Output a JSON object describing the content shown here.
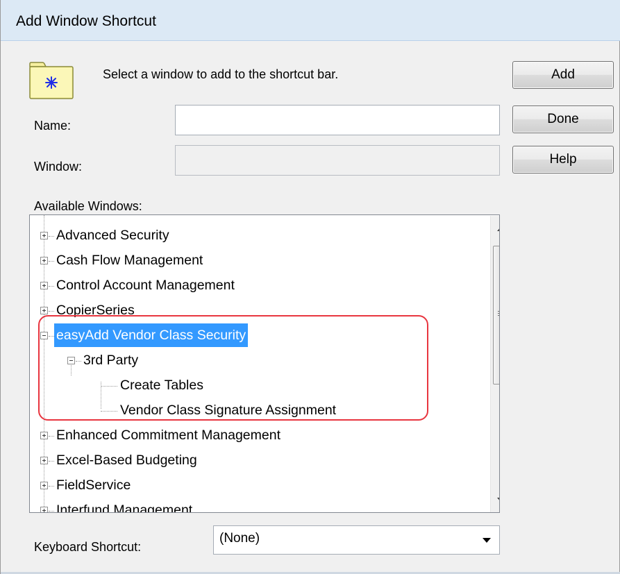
{
  "dialog": {
    "title": "Add Window Shortcut",
    "instruction": "Select a window to add to the shortcut bar."
  },
  "fields": {
    "name_label": "Name:",
    "name_value": "",
    "window_label": "Window:",
    "window_value": ""
  },
  "buttons": {
    "add": "Add",
    "done": "Done",
    "help": "Help"
  },
  "available_windows": {
    "label": "Available Windows:",
    "items": [
      {
        "label": "Advanced Security",
        "state": "collapsed"
      },
      {
        "label": "Cash Flow Management",
        "state": "collapsed"
      },
      {
        "label": "Control Account Management",
        "state": "collapsed"
      },
      {
        "label": "CopierSeries",
        "state": "collapsed"
      },
      {
        "label": "easyAdd Vendor Class Security",
        "state": "expanded",
        "selected": true
      },
      {
        "label": "3rd Party",
        "state": "expanded"
      },
      {
        "label": "Create Tables",
        "state": "leaf"
      },
      {
        "label": "Vendor Class Signature Assignment",
        "state": "leaf"
      },
      {
        "label": "Enhanced Commitment Management",
        "state": "collapsed"
      },
      {
        "label": "Excel-Based Budgeting",
        "state": "collapsed"
      },
      {
        "label": "FieldService",
        "state": "collapsed"
      },
      {
        "label": "Interfund Management",
        "state": "collapsed"
      }
    ]
  },
  "keyboard_shortcut": {
    "label": "Keyboard Shortcut:",
    "selected": "(None)"
  },
  "colors": {
    "selection": "#3399ff",
    "highlight_outline": "#e8353f",
    "titlebar": "#dce9f5"
  }
}
